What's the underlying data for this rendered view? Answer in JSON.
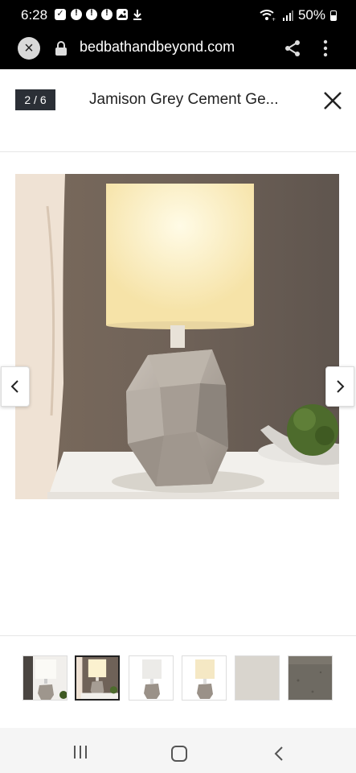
{
  "status_bar": {
    "time": "6:28",
    "battery": "50%",
    "notification_icons": [
      "check-box-icon",
      "alert-icon",
      "alert-icon",
      "alert-icon",
      "image-icon",
      "download-icon"
    ]
  },
  "browser": {
    "url": "bedbathandbeyond.com"
  },
  "gallery": {
    "counter": "2 / 6",
    "title": "Jamison Grey Cement Ge...",
    "current_index": 2,
    "total": 6
  },
  "colors": {
    "wall": "#6f6258",
    "lamp_shade": "#fbf1cf",
    "cement": "#a69d94",
    "nightstand": "#f2f0ec",
    "badge": "#2b2f36"
  }
}
